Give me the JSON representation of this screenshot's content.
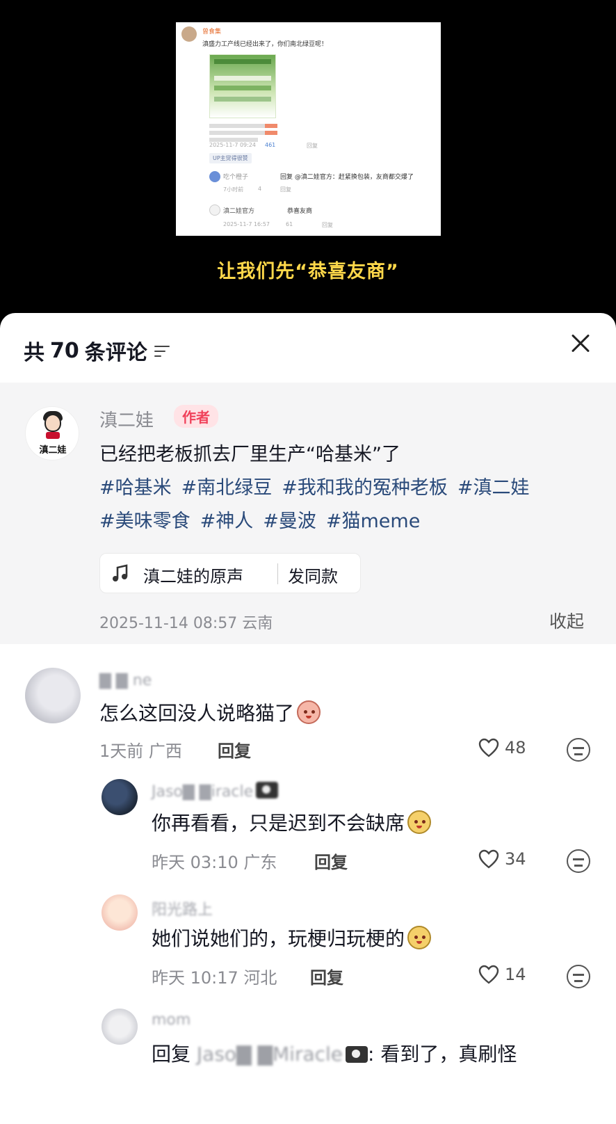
{
  "video": {
    "screenshot": {
      "post_user": "曾食集",
      "post_text": "滇盛力工产线已经出来了，你们南北绿豆呢！",
      "post_meta": "2025-11-7 09:24",
      "post_likes": "461",
      "post_reply": "回复",
      "tag": "UP主觉得很赞",
      "reply1_user": "吃个橙子",
      "reply1_text": "回复 @滇二娃官方：赶紧换包装，友商都交爆了",
      "reply1_meta": "7小时前",
      "reply1_likes": "4",
      "reply1_reply": "回复",
      "reply2_user": "滇二娃官方",
      "reply2_text": "恭喜友商",
      "reply2_meta": "2025-11-7 16:57",
      "reply2_likes": "61",
      "reply2_reply": "回复"
    },
    "caption": "让我们先“恭喜友商”"
  },
  "panel": {
    "count_prefix": "共",
    "count": "70",
    "count_suffix": "条评论"
  },
  "author_comment": {
    "logo_text": "滇二娃",
    "name": "滇二娃",
    "badge": "作者",
    "text": "已经把老板抓去厂里生产“哈基米”了",
    "tags": [
      "#哈基米",
      "#南北绿豆",
      "#我和我的冤种老板",
      "#滇二娃",
      "#美味零食",
      "#神人",
      "#曼波",
      "#猫meme"
    ],
    "music_name": "滇二娃的原声",
    "music_action": "发同款",
    "time": "2025-11-14 08:57 云南",
    "collapse": "收起"
  },
  "comments": [
    {
      "name": "▇ ▇ ne",
      "text": "怎么这回没人说略猫了",
      "sticker": "peach",
      "meta": "1天前 广西",
      "reply": "回复",
      "likes": "48"
    },
    {
      "name": "Jaso▇ ▇iracle",
      "text": "你再看看，只是迟到不会缺席",
      "sticker": "cat",
      "meta": "昨天 03:10 广东",
      "reply": "回复",
      "likes": "34"
    },
    {
      "name": "阳光路上",
      "text": "她们说她们的，玩梗归玩梗的",
      "sticker": "cat",
      "meta": "昨天 10:17 河北",
      "reply": "回复",
      "likes": "14"
    },
    {
      "name": "mom",
      "text_prefix": "回复",
      "text_mention": "Jaso▇ ▇Miracle",
      "text_suffix": ": 看到了，真刷怪"
    }
  ],
  "colors": {
    "caption": "#ffd84a",
    "tag_link": "#2a4a7a",
    "badge_bg": "#ffe3e6",
    "badge_text": "#f0415a",
    "card_bg": "#f5f5f6"
  },
  "icons": [
    "sort-icon",
    "close-icon",
    "music-note-icon",
    "heart-icon",
    "emoji-icon",
    "sticker-icon",
    "camera-icon"
  ]
}
